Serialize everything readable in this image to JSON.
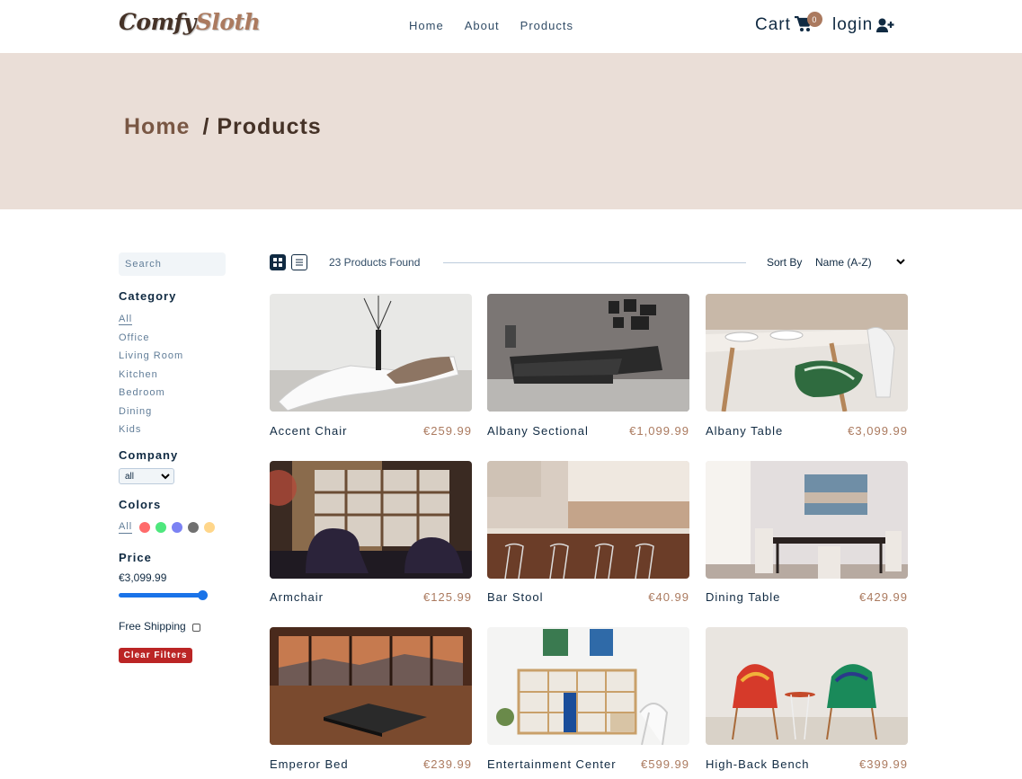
{
  "brand": {
    "part1": "Comfy",
    "part2": "Sloth",
    "color_dark": "#453227",
    "color_accent": "#ab7a5f"
  },
  "nav": {
    "links": [
      "Home",
      "About",
      "Products"
    ],
    "cart_label": "Cart",
    "cart_count": "0",
    "login_label": "login"
  },
  "hero": {
    "crumb_home": "Home",
    "crumb_current": "/ Products"
  },
  "filters": {
    "search_placeholder": "Search",
    "category_title": "Category",
    "categories": [
      "All",
      "Office",
      "Living Room",
      "Kitchen",
      "Bedroom",
      "Dining",
      "Kids"
    ],
    "company_title": "Company",
    "company_value": "all",
    "colors_title": "Colors",
    "colors_all": "All",
    "colors": [
      "#ff6b6b",
      "#4ee77d",
      "#7b82f3",
      "#707070",
      "#ffd68a"
    ],
    "price_title": "Price",
    "price_value": "€3,099.99",
    "price_fraction": 1.0,
    "shipping_label": "Free Shipping",
    "clear_label": "Clear Filters"
  },
  "toolbar": {
    "found": "23 Products Found",
    "sort_label": "Sort By",
    "sort_value": "Name (A-Z)"
  },
  "products": [
    {
      "name": "Accent Chair",
      "price": "€259.99"
    },
    {
      "name": "Albany Sectional",
      "price": "€1,099.99"
    },
    {
      "name": "Albany Table",
      "price": "€3,099.99"
    },
    {
      "name": "Armchair",
      "price": "€125.99"
    },
    {
      "name": "Bar Stool",
      "price": "€40.99"
    },
    {
      "name": "Dining Table",
      "price": "€429.99"
    },
    {
      "name": "Emperor Bed",
      "price": "€239.99"
    },
    {
      "name": "Entertainment Center",
      "price": "€599.99"
    },
    {
      "name": "High-Back Bench",
      "price": "€399.99"
    }
  ]
}
